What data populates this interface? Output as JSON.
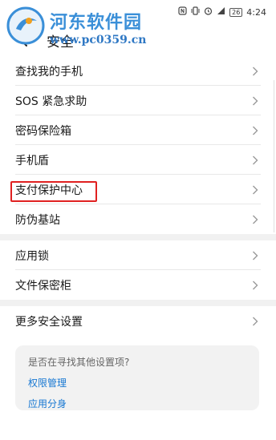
{
  "status_bar": {
    "time": "4:24",
    "battery": "26"
  },
  "watermark": {
    "title": "河东软件园",
    "url": "www.pc0359.cn"
  },
  "header": {
    "title": "安全"
  },
  "groups": [
    {
      "items": [
        {
          "label": "查找我的手机"
        },
        {
          "label": "SOS 紧急求助"
        },
        {
          "label": "密码保险箱"
        },
        {
          "label": "手机盾"
        },
        {
          "label": "支付保护中心"
        },
        {
          "label": "防伪基站"
        }
      ]
    },
    {
      "items": [
        {
          "label": "应用锁"
        },
        {
          "label": "文件保密柜"
        }
      ]
    },
    {
      "items": [
        {
          "label": "更多安全设置"
        }
      ]
    }
  ],
  "suggestion": {
    "question": "是否在寻找其他设置项?",
    "links": [
      "权限管理",
      "应用分身"
    ]
  },
  "colors": {
    "link": "#1677d2",
    "highlight": "#e02020",
    "separator": "#f1f1f1"
  }
}
